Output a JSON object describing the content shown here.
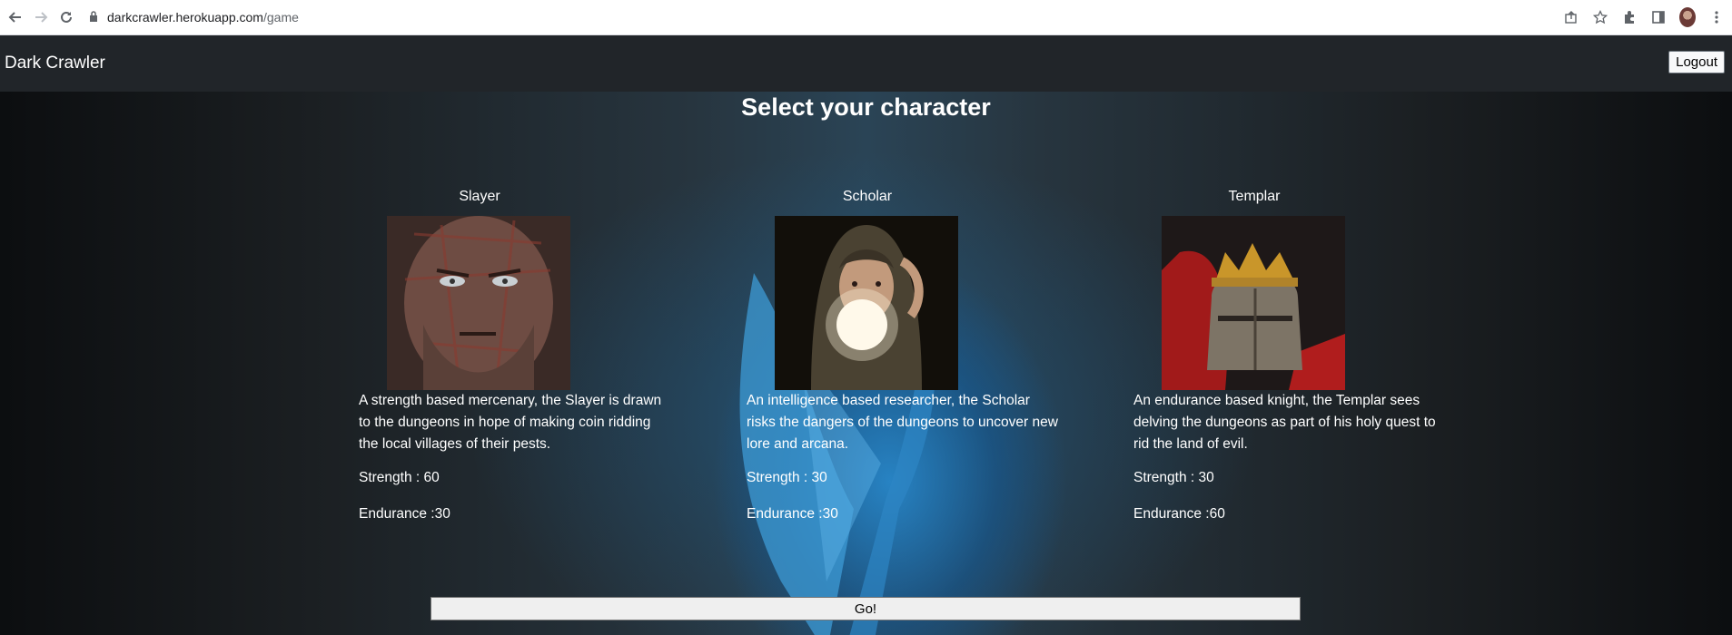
{
  "browser": {
    "url_host": "darkcrawler.herokuapp.com",
    "url_path": "/game"
  },
  "navbar": {
    "brand": "Dark Crawler",
    "logout_label": "Logout"
  },
  "main": {
    "heading": "Select your character",
    "characters": [
      {
        "name": "Slayer",
        "description": "A strength based mercenary, the Slayer is drawn to the dungeons in hope of making coin ridding the local villages of their pests.",
        "strength": "Strength : 60",
        "endurance": "Endurance :30"
      },
      {
        "name": "Scholar",
        "description": "An intelligence based researcher, the Scholar risks the dangers of the dungeons to uncover new lore and arcana.",
        "strength": "Strength : 30",
        "endurance": "Endurance :30"
      },
      {
        "name": "Templar",
        "description": "An endurance based knight, the Templar sees delving the dungeons as part of his holy quest to rid the land of evil.",
        "strength": "Strength : 30",
        "endurance": "Endurance :60"
      }
    ],
    "go_label": "Go!"
  },
  "colors": {
    "navbar_bg": "#212529",
    "accent_blue": "#2a8ccc"
  }
}
